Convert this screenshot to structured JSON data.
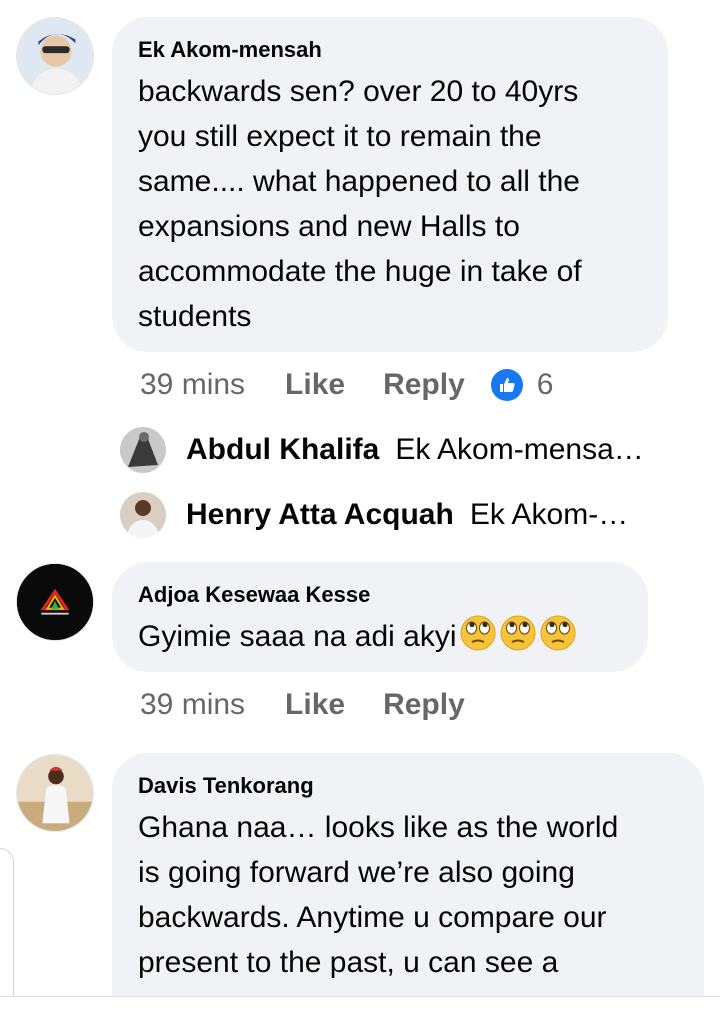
{
  "comments": [
    {
      "author": "Ek Akom-mensah",
      "text": "backwards sen? over 20 to 40yrs\nyou still expect it to remain the\nsame.... what happened to all the\nexpansions and new Halls to\naccommodate the huge in take of\nstudents",
      "time": "39 mins",
      "like_label": "Like",
      "reply_label": "Reply",
      "reaction_icon": "thumbs-up-icon",
      "reaction_count": "6",
      "replies": [
        {
          "name": "Abdul Khalifa",
          "snippet": "Ek Akom-mensa…"
        },
        {
          "name": "Henry Atta Acquah",
          "snippet": "Ek Akom-…"
        }
      ]
    },
    {
      "author": "Adjoa Kesewaa Kesse",
      "text": "Gyimie saaa na adi akyi",
      "emojis": [
        "face-with-rolling-eyes",
        "face-with-rolling-eyes",
        "face-with-rolling-eyes"
      ],
      "time": "39 mins",
      "like_label": "Like",
      "reply_label": "Reply"
    },
    {
      "author": "Davis Tenkorang",
      "text": "Ghana naa… looks like as the world\nis going forward we’re also going\nbackwards. Anytime u compare our\npresent to the past, u can see a"
    }
  ],
  "colors": {
    "bubble": "#f0f2f5",
    "meta": "#65676b",
    "reaction_blue": "#1877f2"
  }
}
